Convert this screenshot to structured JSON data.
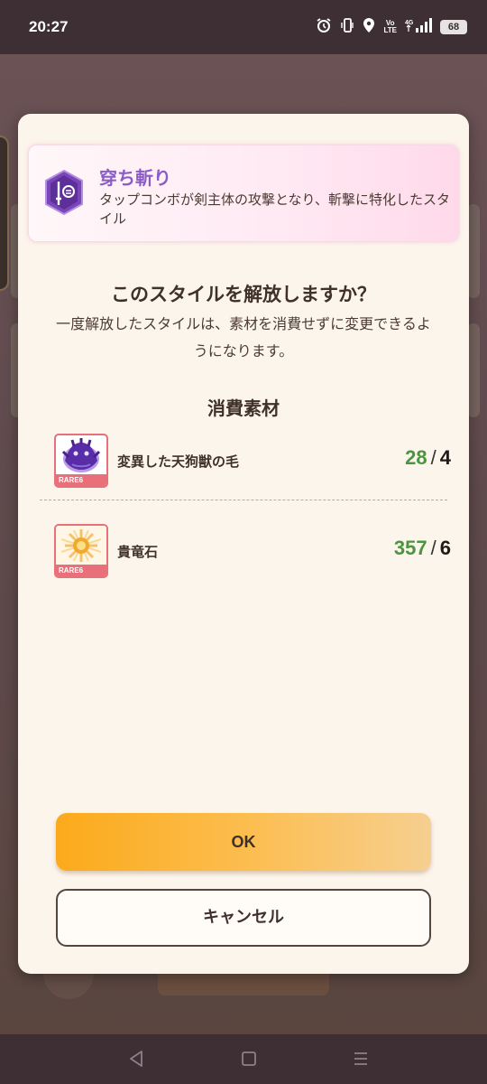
{
  "status_bar": {
    "time": "20:27",
    "lte": "Vo\nLTE",
    "network": "4G",
    "battery": "68"
  },
  "dialog": {
    "style_name": "穿ち斬り",
    "style_description": "タップコンボが剣主体の攻撃となり、斬撃に特化したスタイル",
    "question": "このスタイルを解放しますか？",
    "sub_text": "一度解放したスタイルは、素材を消費せずに変更できるようになります。",
    "materials_title": "消費素材",
    "materials": [
      {
        "rarity": "RARE6",
        "name": "変異した天狗獣の毛",
        "owned": "28",
        "required": "4",
        "icon": "purple-beast-fur-icon"
      },
      {
        "rarity": "RARE6",
        "name": "貴竜石",
        "owned": "357",
        "required": "6",
        "icon": "golden-sun-stone-icon"
      }
    ],
    "ok_label": "OK",
    "cancel_label": "キャンセル"
  },
  "colors": {
    "accent_purple": "#8a5cc6",
    "owned_green": "#4c9440",
    "ok_orange": "#fbaa1b",
    "rare_tag": "#e8707a"
  }
}
